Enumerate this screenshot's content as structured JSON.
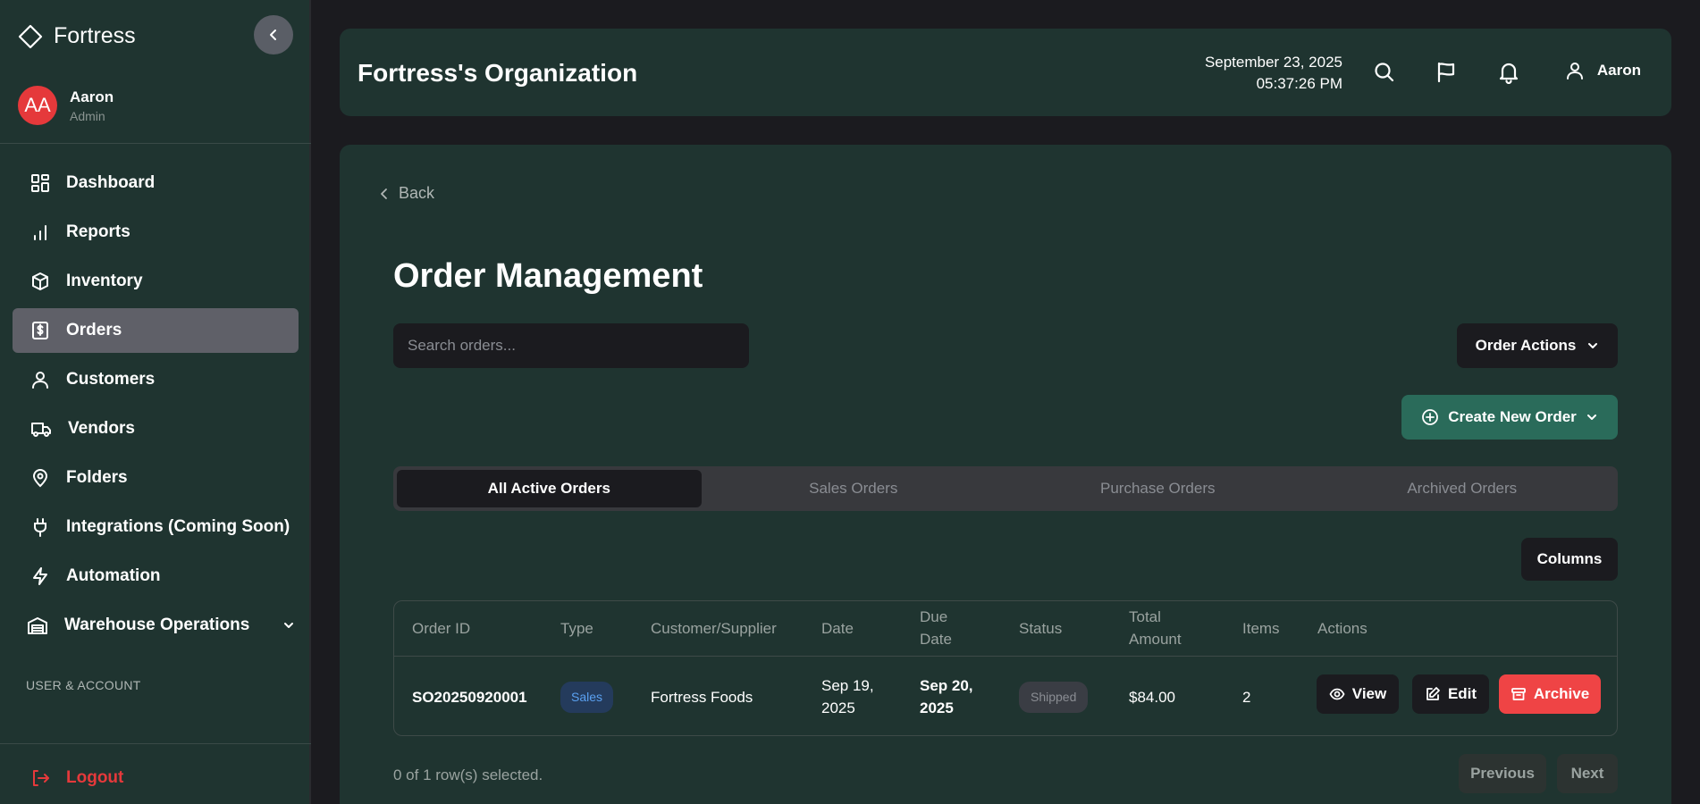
{
  "sidebar": {
    "brand": "Fortress",
    "user": {
      "initials": "AA",
      "name": "Aaron",
      "role": "Admin"
    },
    "items": [
      {
        "label": "Dashboard",
        "icon": "dashboard-icon"
      },
      {
        "label": "Reports",
        "icon": "bar-chart-icon"
      },
      {
        "label": "Inventory",
        "icon": "box-icon"
      },
      {
        "label": "Orders",
        "icon": "receipt-dollar-icon",
        "active": true
      },
      {
        "label": "Customers",
        "icon": "user-icon"
      },
      {
        "label": "Vendors",
        "icon": "truck-icon"
      },
      {
        "label": "Folders",
        "icon": "map-pin-icon"
      },
      {
        "label": "Integrations (Coming Soon)",
        "icon": "plug-icon"
      },
      {
        "label": "Automation",
        "icon": "lightning-icon"
      },
      {
        "label": "Warehouse Operations",
        "icon": "warehouse-icon"
      }
    ],
    "section_label": "USER & ACCOUNT",
    "logout": "Logout"
  },
  "header": {
    "org_title": "Fortress's Organization",
    "date": "September 23, 2025",
    "time": "05:37:26 PM",
    "user_name": "Aaron"
  },
  "main": {
    "back": "Back",
    "title": "Order Management",
    "search_placeholder": "Search orders...",
    "order_actions": "Order Actions",
    "create_order": "Create New Order",
    "tabs": [
      "All Active Orders",
      "Sales Orders",
      "Purchase Orders",
      "Archived Orders"
    ],
    "columns_button": "Columns",
    "table": {
      "headers": {
        "order_id": "Order ID",
        "type": "Type",
        "customer": "Customer/Supplier",
        "date": "Date",
        "due_line1": "Due",
        "due_line2": "Date",
        "status": "Status",
        "total_line1": "Total",
        "total_line2": "Amount",
        "items": "Items",
        "actions": "Actions"
      },
      "rows": [
        {
          "order_id": "SO20250920001",
          "type": "Sales",
          "customer": "Fortress Foods",
          "date_line1": "Sep 19,",
          "date_line2": "2025",
          "due_line1": "Sep 20,",
          "due_line2": "2025",
          "status": "Shipped",
          "total": "$84.00",
          "items": "2",
          "view": "View",
          "edit": "Edit",
          "archive": "Archive"
        }
      ]
    },
    "selected_info": "0 of 1 row(s) selected.",
    "previous": "Previous",
    "next": "Next"
  },
  "colors": {
    "panel": "#1f3430",
    "background": "#1b1b1f",
    "accent_green": "#2a6b5a",
    "danger": "#ef4445",
    "active_nav": "#5f6068"
  }
}
